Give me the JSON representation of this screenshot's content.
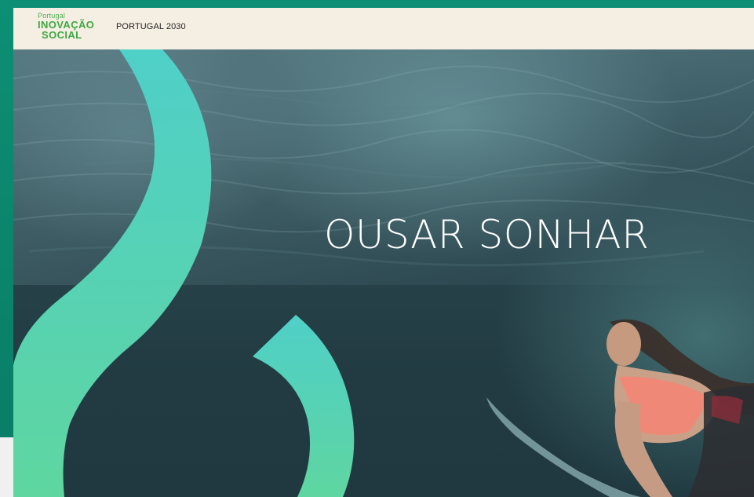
{
  "header": {
    "logo": {
      "line1": "Portugal",
      "line2": "INOVAÇÃO",
      "line3": "SOCIAL"
    },
    "nav_link": "PORTUGAL 2030"
  },
  "hero": {
    "title": "OUSAR SONHAR"
  },
  "colors": {
    "frame_green": "#0c8f74",
    "header_bg": "#f5efe3",
    "logo_green": "#3fa743",
    "brand_gradient_top": "#4fd0c8",
    "brand_gradient_bottom": "#5fd6a0",
    "water_dark": "#223b42"
  },
  "icons": {
    "brand_shape": "infinity-brand-shape"
  }
}
